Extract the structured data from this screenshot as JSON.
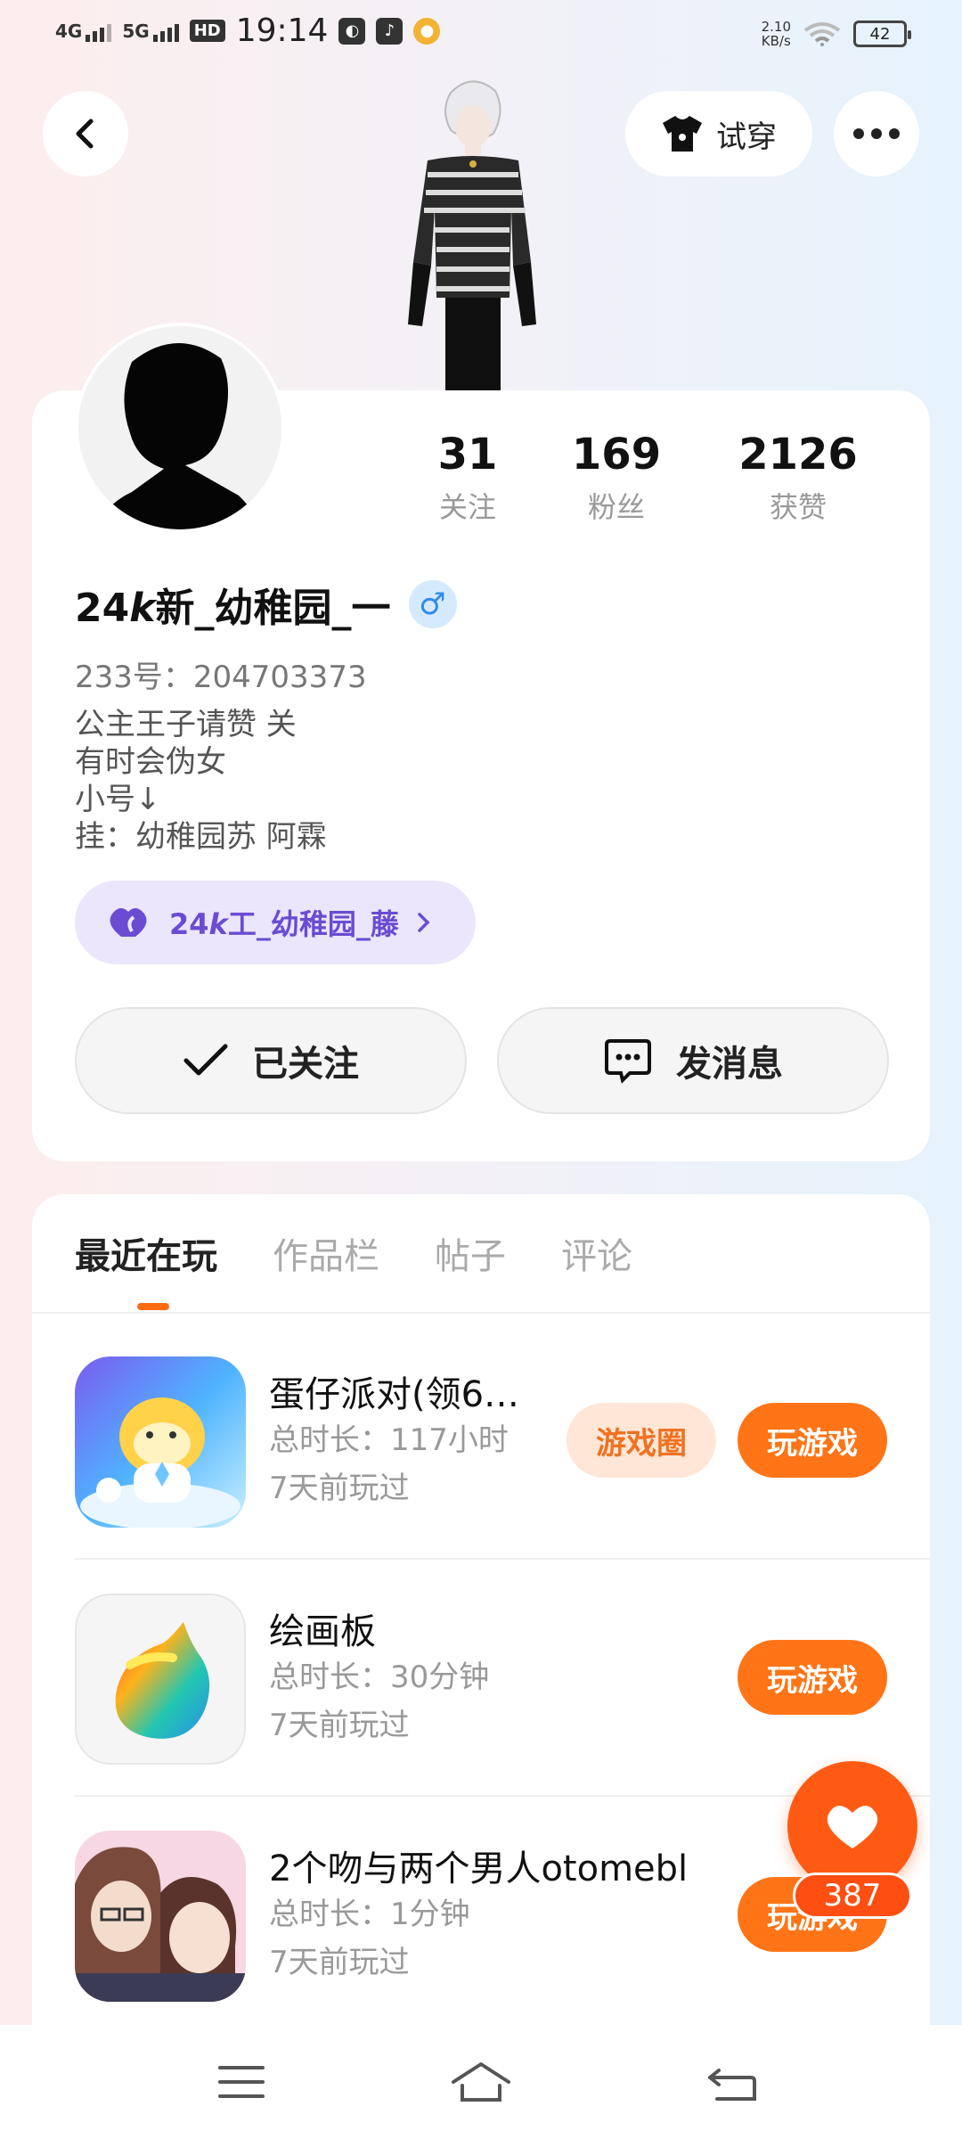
{
  "status_bar": {
    "network_1": "4G",
    "network_2": "5G",
    "hd_badge": "HD",
    "time": "19:14",
    "speed_value": "2.10",
    "speed_unit": "KB/s",
    "battery": "42"
  },
  "header": {
    "tryon_label": "试穿"
  },
  "profile": {
    "stats": [
      {
        "value": "31",
        "label": "关注"
      },
      {
        "value": "169",
        "label": "粉丝"
      },
      {
        "value": "2126",
        "label": "获赞"
      }
    ],
    "username": "24𝙠新_幼稚园_一",
    "gender_symbol": "♂",
    "uid": "233号：204703373",
    "bio_lines": [
      "公主王子请赞 关",
      "有时会伪女",
      "小号↓",
      "挂：幼稚园苏  阿霖"
    ],
    "couple_name": "24𝙠工_幼稚园_藤",
    "follow_label": "已关注",
    "message_label": "发消息"
  },
  "tabs": [
    "最近在玩",
    "作品栏",
    "帖子",
    "评论"
  ],
  "games": [
    {
      "title": "蛋仔派对(领6…",
      "duration": "总时长：117小时",
      "last_played": "7天前玩过",
      "circle_label": "游戏圈",
      "play_label": "玩游戏"
    },
    {
      "title": "绘画板",
      "duration": "总时长：30分钟",
      "last_played": "7天前玩过",
      "play_label": "玩游戏"
    },
    {
      "title": "2个吻与两个男人otomebl",
      "duration": "总时长：1分钟",
      "last_played": "7天前玩过",
      "play_label": "玩游戏"
    }
  ],
  "like": {
    "count": "387"
  },
  "colors": {
    "accent": "#ff7416",
    "couple": "#6a4cd3",
    "gender": "#2c8cf0"
  }
}
